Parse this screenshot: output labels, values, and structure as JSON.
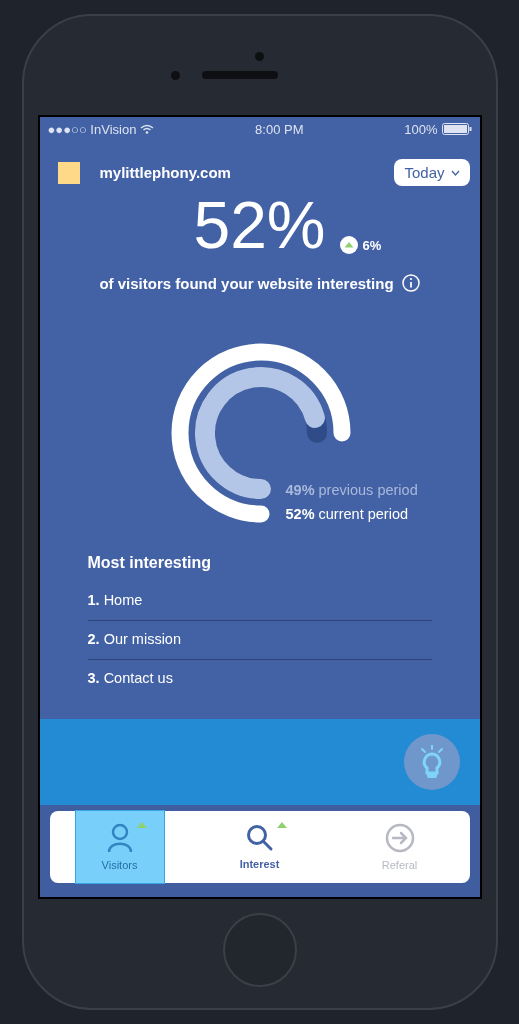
{
  "status_bar": {
    "carrier": "●●●○○ InVision",
    "time": "8:00 PM",
    "battery": "100%"
  },
  "header": {
    "site": "mylittlephony.com",
    "period": "Today"
  },
  "stat": {
    "value": "52%",
    "change": "6%",
    "rising": true,
    "caption": "of visitors found your website interesting"
  },
  "rings": [
    {
      "kind": "inner",
      "legend": "**49%** previous period"
    },
    {
      "kind": "outer",
      "legend": "**52%** current period"
    }
  ],
  "list": {
    "title": "Most interesting",
    "items": [
      {
        "number": "1.",
        "label": "Home"
      },
      {
        "number": "2.",
        "label": "Our mission"
      },
      {
        "number": "3.",
        "label": "Contact us"
      }
    ]
  },
  "tabs": [
    {
      "label": "Visitors",
      "selected": false,
      "trend_up": true,
      "hotspot": true
    },
    {
      "label": "Interest",
      "selected": true,
      "trend_up": true,
      "hotspot": false
    },
    {
      "label": "Referal",
      "selected": false,
      "trend_up": false,
      "hotspot": false
    }
  ]
}
